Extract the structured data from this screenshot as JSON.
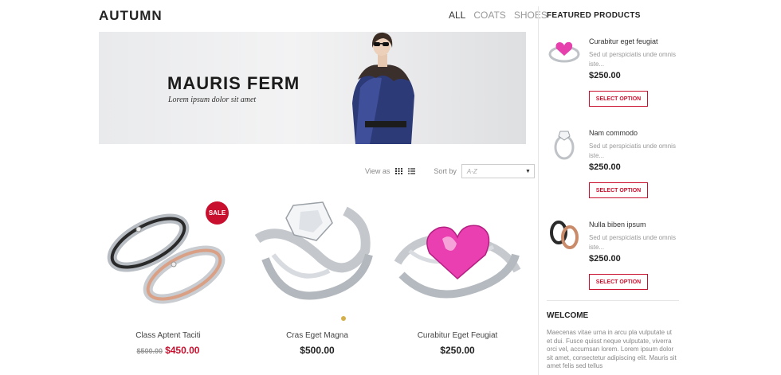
{
  "collection": {
    "title": "AUTUMN",
    "filters": [
      "ALL",
      "COATS",
      "SHOES"
    ]
  },
  "banner": {
    "heading": "MAURIS FERM",
    "subheading": "Lorem ipsum dolor sit amet"
  },
  "toolbar": {
    "view_label": "View as",
    "sort_label": "Sort by",
    "sort_value": "A-Z"
  },
  "products": [
    {
      "name": "Class Aptent Taciti",
      "old_price": "$500.00",
      "price": "$450.00",
      "badge": "SALE"
    },
    {
      "name": "Cras Eget Magna",
      "price": "$500.00"
    },
    {
      "name": "Curabitur Eget Feugiat",
      "price": "$250.00"
    }
  ],
  "featured": {
    "heading": "FEATURED PRODUCTS",
    "items": [
      {
        "name": "Curabitur eget feugiat",
        "desc": "Sed ut perspiciatis unde omnis iste...",
        "price": "$250.00",
        "button": "SELECT OPTION"
      },
      {
        "name": "Nam commodo",
        "desc": "Sed ut perspiciatis unde omnis iste...",
        "price": "$250.00",
        "button": "SELECT OPTION"
      },
      {
        "name": "Nulla biben ipsum",
        "desc": "Sed ut perspiciatis unde omnis iste...",
        "price": "$250.00",
        "button": "SELECT OPTION"
      }
    ]
  },
  "welcome": {
    "heading": "WELCOME",
    "text": "Maecenas vitae urna in arcu pla vulputate ut et dui. Fusce quisst neque vulputate, viverra orci vel, accumsan lorem. Lorem ipsum dolor sit amet, consectetur adipiscing elit. Mauris sit amet felis sed tellus"
  },
  "colors": {
    "accent": "#c8102e",
    "text": "#222222",
    "muted": "#999999"
  }
}
